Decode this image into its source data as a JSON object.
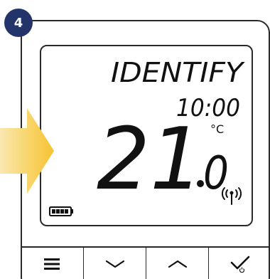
{
  "step": {
    "number": "4"
  },
  "display": {
    "mode_text": "IDENTIFY",
    "time": "10:00",
    "temperature_integer": "21",
    "temperature_decimal": "0",
    "unit": "°C"
  },
  "icons": {
    "battery": "battery-full-icon",
    "wireless": "wireless-signal-icon",
    "menu": "menu-icon",
    "down": "chevron-down-icon",
    "up": "chevron-up-icon",
    "confirm": "checkmark-power-icon"
  },
  "colors": {
    "badge": "#22346a",
    "arrow": "#f8c640",
    "outline": "#2a2a2a"
  }
}
